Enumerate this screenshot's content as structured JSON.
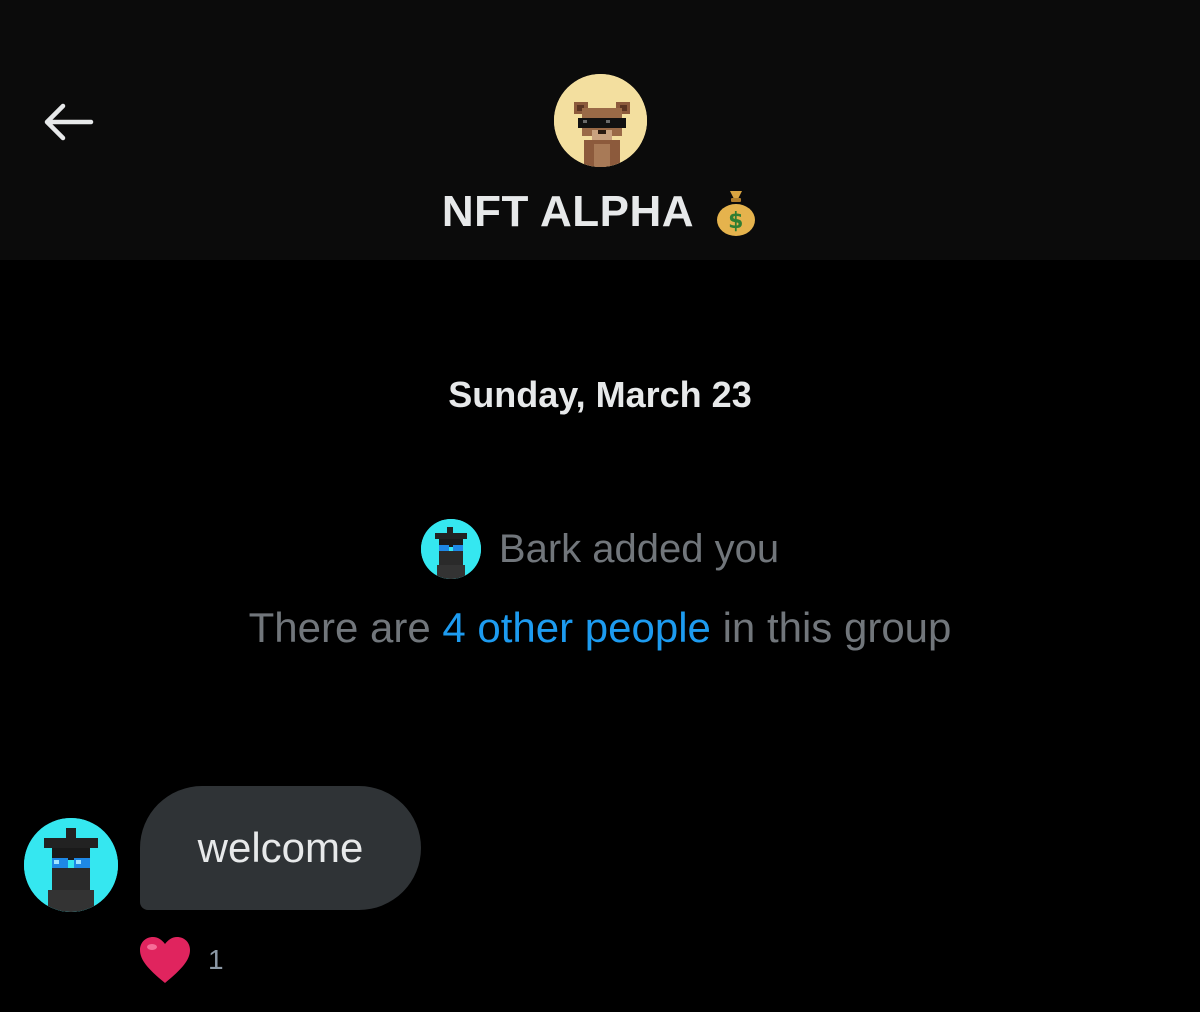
{
  "header": {
    "title": "NFT ALPHA",
    "title_emoji": "💰",
    "back_icon": "arrow-left-icon",
    "avatar_icon": "pixel-bear-avatar"
  },
  "conversation": {
    "date_divider": "Sunday, March 23",
    "system_added": "Bark added you",
    "members_prefix": "There are ",
    "members_link": "4 other people",
    "members_suffix": " in this group",
    "messages": [
      {
        "text": "welcome",
        "reaction_icon": "heart-icon",
        "reaction_count": "1"
      }
    ]
  },
  "colors": {
    "background": "#000000",
    "header_bg": "#0b0b0b",
    "bubble_bg": "#2f3336",
    "link": "#1d9bf0",
    "muted_text": "#71767b",
    "avatar_cyan": "#35e7f0",
    "heart": "#e0245e"
  }
}
